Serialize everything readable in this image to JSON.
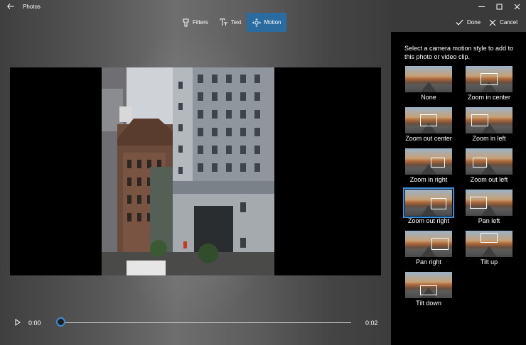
{
  "app": {
    "title": "Photos"
  },
  "toolbar": {
    "filters_label": "Filters",
    "text_label": "Text",
    "motion_label": "Motion",
    "done_label": "Done",
    "cancel_label": "Cancel"
  },
  "playback": {
    "current_time": "0:00",
    "total_time": "0:02",
    "progress": 0
  },
  "panel": {
    "instruction": "Select a camera motion style to add to this photo or video clip.",
    "styles": [
      {
        "label": "None"
      },
      {
        "label": "Zoom in center"
      },
      {
        "label": "Zoom out center"
      },
      {
        "label": "Zoom in left"
      },
      {
        "label": "Zoom in right"
      },
      {
        "label": "Zoom out left"
      },
      {
        "label": "Zoom out right"
      },
      {
        "label": "Pan left"
      },
      {
        "label": "Pan right"
      },
      {
        "label": "Tilt up"
      },
      {
        "label": "Tilt down"
      }
    ],
    "selected": "Zoom out right"
  },
  "colors": {
    "accent": "#2b6ca0",
    "panel_bg": "#000000",
    "slider_thumb": "#3a8fd8"
  },
  "icons": {
    "back": "back-arrow-icon",
    "minimize": "minimize-icon",
    "maximize": "maximize-icon",
    "close": "close-icon",
    "filters": "filters-icon",
    "text": "text-icon",
    "motion": "motion-icon",
    "done": "checkmark-icon",
    "cancel": "close-icon",
    "play": "play-icon"
  }
}
